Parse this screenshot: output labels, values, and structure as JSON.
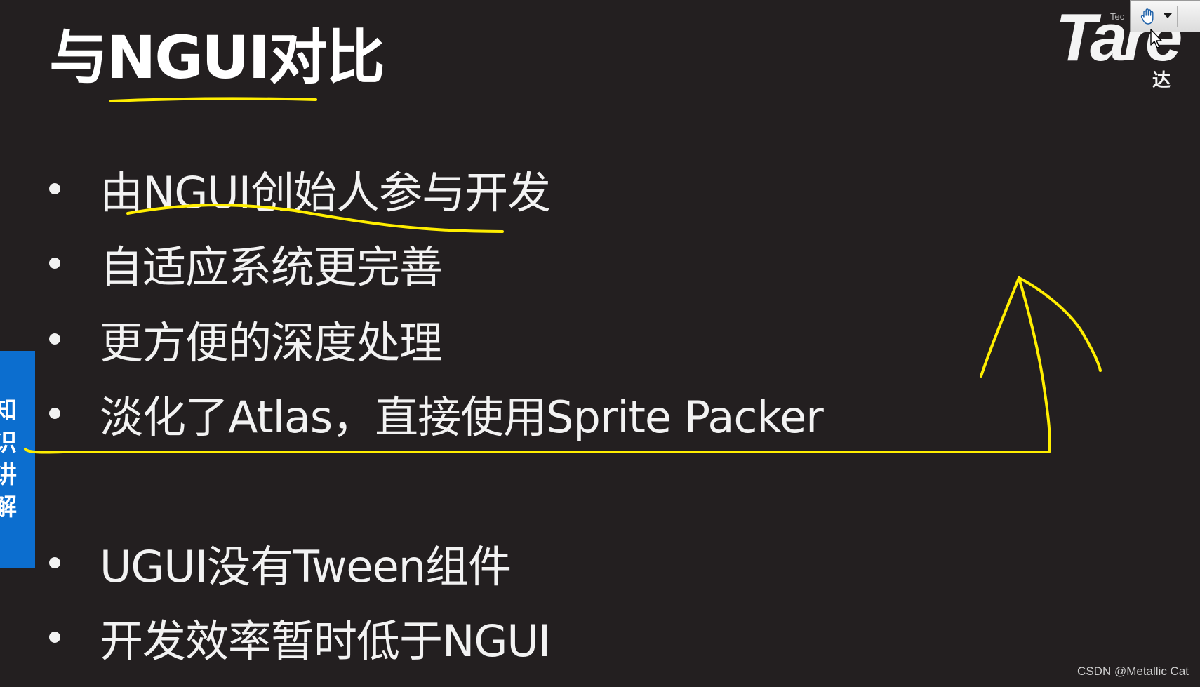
{
  "slide": {
    "title": "与NGUI对比",
    "bullets": [
      "由NGUI创始人参与开发",
      "自适应系统更完善",
      "更方便的深度处理",
      "淡化了Atlas，直接使用Sprite Packer",
      "UGUI没有Tween组件",
      "开发效率暂时低于NGUI"
    ]
  },
  "side_tab": {
    "chars": [
      "知",
      "识",
      "讲",
      "解"
    ]
  },
  "logo": {
    "text": "Tare",
    "small_text": "Tec",
    "cn_text": "达"
  },
  "toolbar": {
    "hand_tool_icon": "hand-icon",
    "dropdown_icon": "chevron-down-icon"
  },
  "watermark": {
    "text": "CSDN @Metallic Cat"
  },
  "colors": {
    "background": "#231f20",
    "annotation": "#ffee00",
    "side_tab": "#0c6ecf",
    "text": "#f2f2f2"
  }
}
